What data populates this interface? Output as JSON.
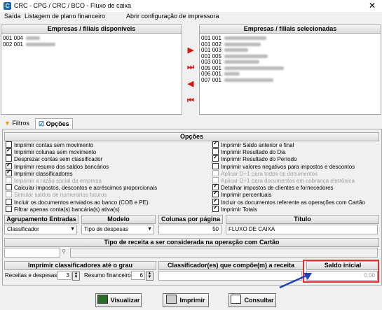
{
  "window": {
    "title": "CRC - CPG / CRC / BCO - Fluxo de caixa",
    "close": "✕"
  },
  "menu": [
    "Saída",
    "Listagem de plano financeiro",
    "Abrir configuração de impressora"
  ],
  "available": {
    "header": "Empresas / filiais disponíveis",
    "items": [
      {
        "code": "001 004"
      },
      {
        "code": "002 001"
      }
    ]
  },
  "selected": {
    "header": "Empresas / filiais selecionadas",
    "items": [
      {
        "code": "001 001"
      },
      {
        "code": "001 002"
      },
      {
        "code": "001 003"
      },
      {
        "code": "001 005"
      },
      {
        "code": "003 001"
      },
      {
        "code": "005 001"
      },
      {
        "code": "006 001"
      },
      {
        "code": "007 001"
      }
    ]
  },
  "tabs": {
    "filtros": "Filtros",
    "opcoes": "Opções"
  },
  "options": {
    "header": "Opções",
    "left": [
      {
        "label": "Imprimir contas sem movimento",
        "checked": false,
        "disabled": false
      },
      {
        "label": "Imprimir colunas sem movimento",
        "checked": true,
        "disabled": false
      },
      {
        "label": "Desprezar contas sem  classificador",
        "checked": false,
        "disabled": false
      },
      {
        "label": "Imprimir resumo dos saldos bancários",
        "checked": true,
        "disabled": false
      },
      {
        "label": "Imprimir classificadores",
        "checked": true,
        "disabled": false
      },
      {
        "label": "Imprimir a razão social da empresa",
        "checked": false,
        "disabled": true
      },
      {
        "label": "Calcular impostos, descontos e acréscimos proporcionais",
        "checked": false,
        "disabled": false
      },
      {
        "label": "Simular saldos de numerários futuros",
        "checked": false,
        "disabled": true
      },
      {
        "label": "Incluir os documentos enviados ao banco (COB e PE)",
        "checked": false,
        "disabled": false
      },
      {
        "label": "Filtrar apenas conta(s) bancária(s) ativa(s)",
        "checked": false,
        "disabled": false
      }
    ],
    "right": [
      {
        "label": "Imprimir Saldo anterior e final",
        "checked": true,
        "disabled": false
      },
      {
        "label": "Imprimir Resultado do Dia",
        "checked": false,
        "disabled": false
      },
      {
        "label": "Imprimir Resultado do Período",
        "checked": true,
        "disabled": false
      },
      {
        "label": "Imprimir valores negativos para impostos e descontos",
        "checked": false,
        "disabled": false
      },
      {
        "label": "Aplicar D+1 para todos os documentos",
        "checked": false,
        "disabled": true
      },
      {
        "label": "Aplicar D+1 para documentos em cobrança eletrônica",
        "checked": false,
        "disabled": true
      },
      {
        "label": "Detalhar impostos de clientes e fornecedores",
        "checked": true,
        "disabled": false
      },
      {
        "label": "Imprimir percentuais",
        "checked": true,
        "disabled": false
      },
      {
        "label": "Incluir os documentos referente as operações com Cartão",
        "checked": true,
        "disabled": false
      },
      {
        "label": "Imprimir Totais",
        "checked": true,
        "disabled": false
      }
    ]
  },
  "grouping": {
    "header": "Agrupamento Entradas",
    "value": "Classificador"
  },
  "model": {
    "header": "Modelo",
    "value": "Tipo de despesas"
  },
  "columns": {
    "header": "Colunas por página",
    "value": "50"
  },
  "titulo": {
    "header": "Título",
    "value": "FLUXO DE CAIXA"
  },
  "receita_tipo": {
    "header": "Tipo de receita a ser considerada na operação com Cartão",
    "value": "",
    "description": ""
  },
  "classif_grau": {
    "header": "Imprimir classificadores até o grau",
    "receitas_label": "Receitas e despesas",
    "receitas_value": "3",
    "resumo_label": "Resumo financeiro",
    "resumo_value": "6"
  },
  "classif_receita": {
    "header": "Classificador(es) que compõe(m) a receita",
    "value": ""
  },
  "saldo_inicial": {
    "header": "Saldo inicial",
    "value": "0,00"
  },
  "buttons": {
    "visualizar": "Visualizar",
    "imprimir": "Imprimir",
    "consultar": "Consultar"
  },
  "colors": {
    "highlight": "#e03030",
    "arrow": "#1f3fbf"
  }
}
